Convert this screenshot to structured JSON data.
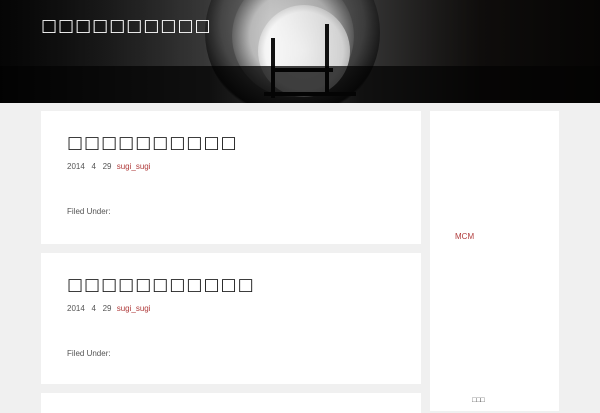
{
  "header": {
    "site_title": "□□□□□□□□□□"
  },
  "posts": [
    {
      "title": "□□□□□□□□□□",
      "date_year": "2014",
      "date_month": "4",
      "date_day": "29",
      "author": "sugi_sugi",
      "filed_under": "Filed Under:"
    },
    {
      "title": "□□□□□□□□□□□",
      "date_year": "2014",
      "date_month": "4",
      "date_day": "29",
      "author": "sugi_sugi",
      "filed_under": "Filed Under:"
    }
  ],
  "sidebar": {
    "link": "MCM",
    "bottom_text": "□□□"
  }
}
